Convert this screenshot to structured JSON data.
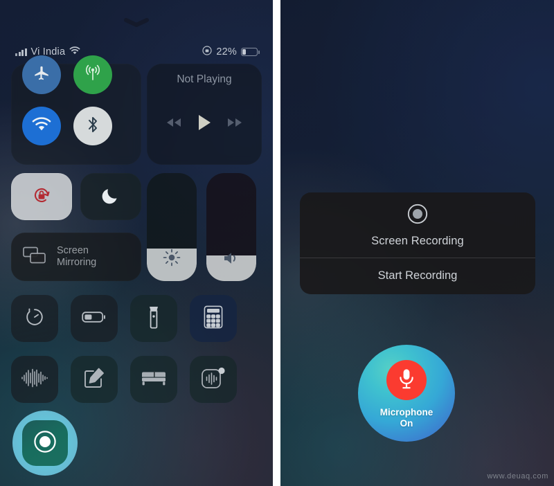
{
  "meta": {
    "watermark": "www.deuaq.com",
    "accent_record": "#6ACEE4",
    "accent_mic_red": "#FB3B30",
    "accent_wifi_blue": "#1D6FD4",
    "accent_cellular_green": "#2FA24A",
    "accent_airplane_blue": "#3A6EA8",
    "accent_rotlock_red": "#C03030"
  },
  "left_panel": {
    "name": "control-center",
    "grabber_icon": "chevron-down-icon",
    "statusbar": {
      "signal_icon": "signal-bars-icon",
      "carrier": "Vi India",
      "wifi_icon": "wifi-icon",
      "lock_icon": "rotation-lock-icon",
      "battery_percent": "22%",
      "battery_level": 22,
      "battery_icon": "battery-icon"
    },
    "connectivity": [
      {
        "name": "airplane-mode-button",
        "icon": "airplane-icon",
        "state": "off"
      },
      {
        "name": "cellular-data-button",
        "icon": "cellular-antenna-icon",
        "state": "on"
      },
      {
        "name": "wifi-button",
        "icon": "wifi-icon",
        "state": "on"
      },
      {
        "name": "bluetooth-button",
        "icon": "bluetooth-icon",
        "state": "on"
      }
    ],
    "media": {
      "title": "Not Playing",
      "previous_icon": "rewind-icon",
      "play_icon": "play-icon",
      "next_icon": "fast-forward-icon"
    },
    "toggles": [
      {
        "name": "rotation-lock-button",
        "icon": "rotation-lock-icon",
        "state": "on"
      },
      {
        "name": "do-not-disturb-button",
        "icon": "moon-icon",
        "state": "off"
      }
    ],
    "screen_mirroring": {
      "icon": "screen-mirroring-icon",
      "label_line1": "Screen",
      "label_line2": "Mirroring"
    },
    "sliders": [
      {
        "name": "brightness-slider",
        "icon": "brightness-icon",
        "value": 30
      },
      {
        "name": "volume-slider",
        "icon": "volume-icon",
        "value": 24
      }
    ],
    "shortcuts": [
      {
        "name": "timer-tile",
        "icon": "timer-icon"
      },
      {
        "name": "low-power-mode-tile",
        "icon": "battery-icon"
      },
      {
        "name": "flashlight-tile",
        "icon": "flashlight-icon"
      },
      {
        "name": "calculator-tile",
        "icon": "calculator-icon"
      },
      {
        "name": "voice-memos-tile",
        "icon": "waveform-icon"
      },
      {
        "name": "notes-tile",
        "icon": "notes-pencil-icon"
      },
      {
        "name": "sleep-mode-tile",
        "icon": "bed-icon"
      },
      {
        "name": "sound-recognition-tile",
        "icon": "sound-recognition-icon"
      }
    ],
    "record_button": {
      "name": "screen-record-button",
      "icon": "record-circle-icon",
      "state": "highlighted"
    }
  },
  "right_panel": {
    "name": "screen-recording-sheet",
    "sheet": {
      "icon": "record-circle-icon",
      "title": "Screen Recording",
      "action_label": "Start Recording"
    },
    "microphone": {
      "icon": "microphone-icon",
      "label": "Microphone",
      "state_label": "On"
    }
  }
}
